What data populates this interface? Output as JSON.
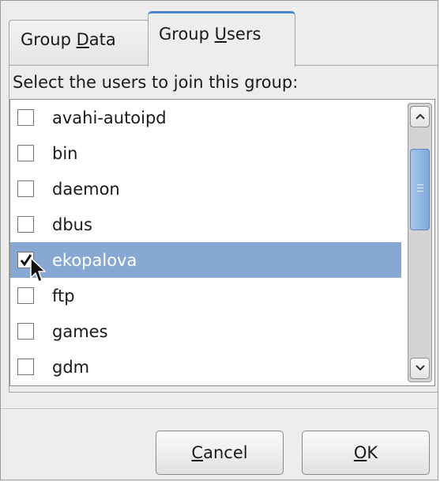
{
  "tabs": [
    {
      "label_pre": "Group ",
      "mnemonic": "D",
      "label_post": "ata",
      "active": false
    },
    {
      "label_pre": "Group ",
      "mnemonic": "U",
      "label_post": "sers",
      "active": true
    }
  ],
  "instruction": "Select the users to join this group:",
  "users": [
    {
      "name": "avahi-autoipd",
      "checked": false,
      "selected": false
    },
    {
      "name": "bin",
      "checked": false,
      "selected": false
    },
    {
      "name": "daemon",
      "checked": false,
      "selected": false
    },
    {
      "name": "dbus",
      "checked": false,
      "selected": false
    },
    {
      "name": "ekopalova",
      "checked": true,
      "selected": true
    },
    {
      "name": "ftp",
      "checked": false,
      "selected": false
    },
    {
      "name": "games",
      "checked": false,
      "selected": false
    },
    {
      "name": "gdm",
      "checked": false,
      "selected": false
    }
  ],
  "buttons": {
    "cancel": {
      "mnemonic": "C",
      "rest": "ancel"
    },
    "ok": {
      "mnemonic": "O",
      "rest": "K"
    }
  },
  "icons": {
    "check": "check-mark-icon",
    "scroll_up": "chevron-up-icon",
    "scroll_down": "chevron-down-icon",
    "cursor": "mouse-pointer-icon"
  },
  "colors": {
    "selection": "#86a8d3",
    "tab_accent": "#4f86c9",
    "scroll_thumb": "#7fa9dc"
  }
}
